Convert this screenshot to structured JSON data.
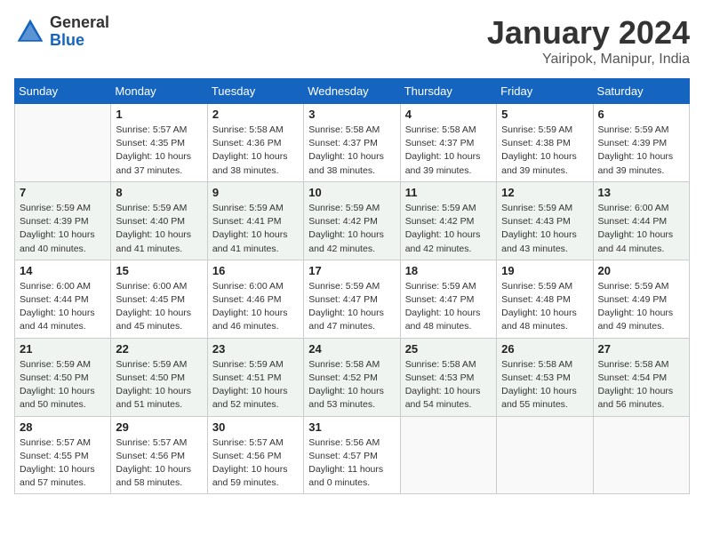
{
  "header": {
    "logo_general": "General",
    "logo_blue": "Blue",
    "month_title": "January 2024",
    "location": "Yairipok, Manipur, India"
  },
  "weekdays": [
    "Sunday",
    "Monday",
    "Tuesday",
    "Wednesday",
    "Thursday",
    "Friday",
    "Saturday"
  ],
  "weeks": [
    [
      {
        "day": "",
        "info": ""
      },
      {
        "day": "1",
        "info": "Sunrise: 5:57 AM\nSunset: 4:35 PM\nDaylight: 10 hours\nand 37 minutes."
      },
      {
        "day": "2",
        "info": "Sunrise: 5:58 AM\nSunset: 4:36 PM\nDaylight: 10 hours\nand 38 minutes."
      },
      {
        "day": "3",
        "info": "Sunrise: 5:58 AM\nSunset: 4:37 PM\nDaylight: 10 hours\nand 38 minutes."
      },
      {
        "day": "4",
        "info": "Sunrise: 5:58 AM\nSunset: 4:37 PM\nDaylight: 10 hours\nand 39 minutes."
      },
      {
        "day": "5",
        "info": "Sunrise: 5:59 AM\nSunset: 4:38 PM\nDaylight: 10 hours\nand 39 minutes."
      },
      {
        "day": "6",
        "info": "Sunrise: 5:59 AM\nSunset: 4:39 PM\nDaylight: 10 hours\nand 39 minutes."
      }
    ],
    [
      {
        "day": "7",
        "info": "Sunrise: 5:59 AM\nSunset: 4:39 PM\nDaylight: 10 hours\nand 40 minutes."
      },
      {
        "day": "8",
        "info": "Sunrise: 5:59 AM\nSunset: 4:40 PM\nDaylight: 10 hours\nand 41 minutes."
      },
      {
        "day": "9",
        "info": "Sunrise: 5:59 AM\nSunset: 4:41 PM\nDaylight: 10 hours\nand 41 minutes."
      },
      {
        "day": "10",
        "info": "Sunrise: 5:59 AM\nSunset: 4:42 PM\nDaylight: 10 hours\nand 42 minutes."
      },
      {
        "day": "11",
        "info": "Sunrise: 5:59 AM\nSunset: 4:42 PM\nDaylight: 10 hours\nand 42 minutes."
      },
      {
        "day": "12",
        "info": "Sunrise: 5:59 AM\nSunset: 4:43 PM\nDaylight: 10 hours\nand 43 minutes."
      },
      {
        "day": "13",
        "info": "Sunrise: 6:00 AM\nSunset: 4:44 PM\nDaylight: 10 hours\nand 44 minutes."
      }
    ],
    [
      {
        "day": "14",
        "info": "Sunrise: 6:00 AM\nSunset: 4:44 PM\nDaylight: 10 hours\nand 44 minutes."
      },
      {
        "day": "15",
        "info": "Sunrise: 6:00 AM\nSunset: 4:45 PM\nDaylight: 10 hours\nand 45 minutes."
      },
      {
        "day": "16",
        "info": "Sunrise: 6:00 AM\nSunset: 4:46 PM\nDaylight: 10 hours\nand 46 minutes."
      },
      {
        "day": "17",
        "info": "Sunrise: 5:59 AM\nSunset: 4:47 PM\nDaylight: 10 hours\nand 47 minutes."
      },
      {
        "day": "18",
        "info": "Sunrise: 5:59 AM\nSunset: 4:47 PM\nDaylight: 10 hours\nand 48 minutes."
      },
      {
        "day": "19",
        "info": "Sunrise: 5:59 AM\nSunset: 4:48 PM\nDaylight: 10 hours\nand 48 minutes."
      },
      {
        "day": "20",
        "info": "Sunrise: 5:59 AM\nSunset: 4:49 PM\nDaylight: 10 hours\nand 49 minutes."
      }
    ],
    [
      {
        "day": "21",
        "info": "Sunrise: 5:59 AM\nSunset: 4:50 PM\nDaylight: 10 hours\nand 50 minutes."
      },
      {
        "day": "22",
        "info": "Sunrise: 5:59 AM\nSunset: 4:50 PM\nDaylight: 10 hours\nand 51 minutes."
      },
      {
        "day": "23",
        "info": "Sunrise: 5:59 AM\nSunset: 4:51 PM\nDaylight: 10 hours\nand 52 minutes."
      },
      {
        "day": "24",
        "info": "Sunrise: 5:58 AM\nSunset: 4:52 PM\nDaylight: 10 hours\nand 53 minutes."
      },
      {
        "day": "25",
        "info": "Sunrise: 5:58 AM\nSunset: 4:53 PM\nDaylight: 10 hours\nand 54 minutes."
      },
      {
        "day": "26",
        "info": "Sunrise: 5:58 AM\nSunset: 4:53 PM\nDaylight: 10 hours\nand 55 minutes."
      },
      {
        "day": "27",
        "info": "Sunrise: 5:58 AM\nSunset: 4:54 PM\nDaylight: 10 hours\nand 56 minutes."
      }
    ],
    [
      {
        "day": "28",
        "info": "Sunrise: 5:57 AM\nSunset: 4:55 PM\nDaylight: 10 hours\nand 57 minutes."
      },
      {
        "day": "29",
        "info": "Sunrise: 5:57 AM\nSunset: 4:56 PM\nDaylight: 10 hours\nand 58 minutes."
      },
      {
        "day": "30",
        "info": "Sunrise: 5:57 AM\nSunset: 4:56 PM\nDaylight: 10 hours\nand 59 minutes."
      },
      {
        "day": "31",
        "info": "Sunrise: 5:56 AM\nSunset: 4:57 PM\nDaylight: 11 hours\nand 0 minutes."
      },
      {
        "day": "",
        "info": ""
      },
      {
        "day": "",
        "info": ""
      },
      {
        "day": "",
        "info": ""
      }
    ]
  ]
}
